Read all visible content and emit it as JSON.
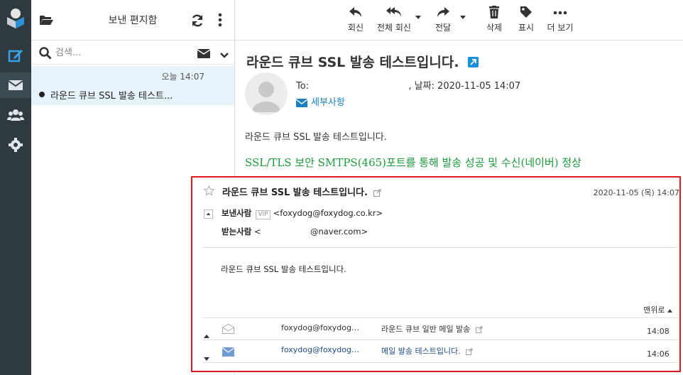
{
  "list": {
    "folder_title": "보낸 편지함",
    "search_placeholder": "검색...",
    "items": [
      {
        "time": "오늘 14:07",
        "subject": "라운드 큐브 SSL 발송 테스트..."
      }
    ]
  },
  "toolbar": {
    "reply": "회신",
    "reply_all": "전체 회신",
    "forward": "전달",
    "delete": "삭제",
    "mark": "표시",
    "more": "더 보기"
  },
  "message": {
    "subject": "라운드 큐브 SSL 발송 테스트입니다.",
    "to_label": "To:",
    "date_text": ", 날짜: 2020-11-05 14:07",
    "details_label": "세부사항",
    "body_line1": "라운드 큐브 SSL 발송 테스트입니다.",
    "body_line2": "SSL/TLS 보안 SMTPS(465)포트를 통해 발송 성공 및 수신(네이버) 정상"
  },
  "embedded": {
    "subject": "라운드 큐브 SSL 발송 테스트입니다.",
    "date": "2020-11-05 (목) 14:07",
    "sender_label": "보낸사람",
    "vip": "VIP",
    "sender_email": "<foxydog@foxydog.co.kr>",
    "recipient_label": "받는사람",
    "recipient_open": "<",
    "recipient_email": "@naver.com>",
    "body": "라운드 큐브 SSL 발송 테스트입니다.",
    "to_top": "맨위로",
    "thread": [
      {
        "from": "foxydog@foxydog…",
        "subject": "라운드 큐브 일반 메일 발송",
        "time": "14:08"
      },
      {
        "from": "foxydog@foxydog…",
        "subject": "메일 발송 테스트입니다.",
        "time": "14:06"
      }
    ]
  }
}
